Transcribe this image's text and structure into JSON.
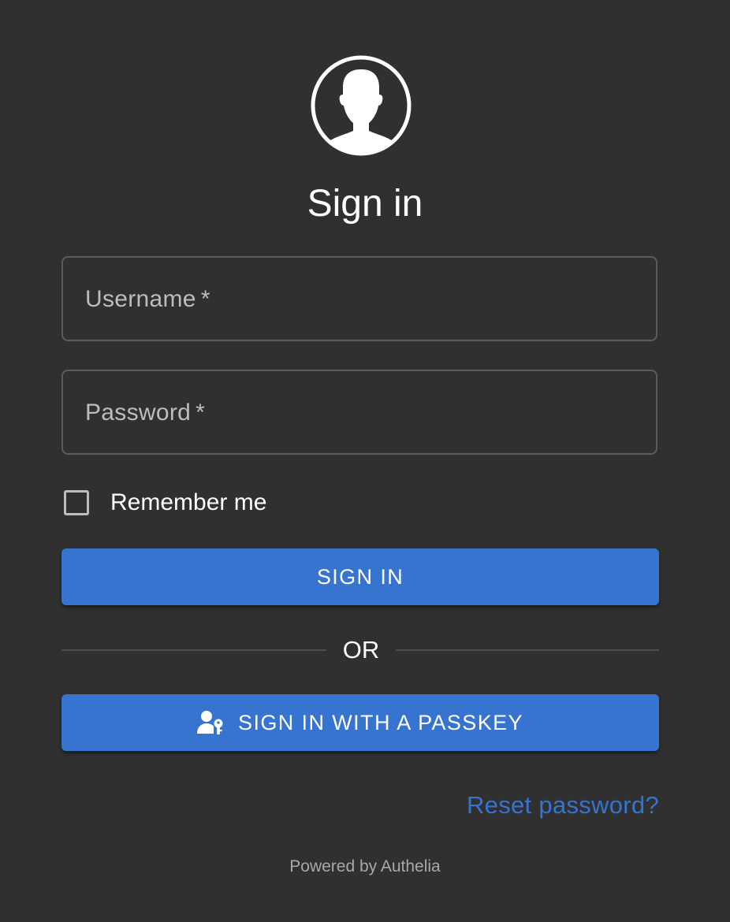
{
  "header": {
    "avatar_icon": "user-circle-icon",
    "title": "Sign in"
  },
  "form": {
    "username": {
      "label": "Username",
      "required_marker": "*",
      "value": ""
    },
    "password": {
      "label": "Password",
      "required_marker": "*",
      "value": ""
    },
    "remember_me": {
      "label": "Remember me",
      "checked": false
    },
    "sign_in_label": "SIGN IN",
    "divider_label": "OR",
    "passkey": {
      "icon": "passkey-icon",
      "label": "SIGN IN WITH A PASSKEY"
    },
    "reset_password_label": "Reset password?"
  },
  "footer": {
    "powered_by": "Powered by Authelia"
  },
  "colors": {
    "background": "#303030",
    "accent": "#3674d0",
    "field_border": "#5c5c5c",
    "label_text": "#bdbdbd",
    "footer_text": "#a8a8a8"
  }
}
